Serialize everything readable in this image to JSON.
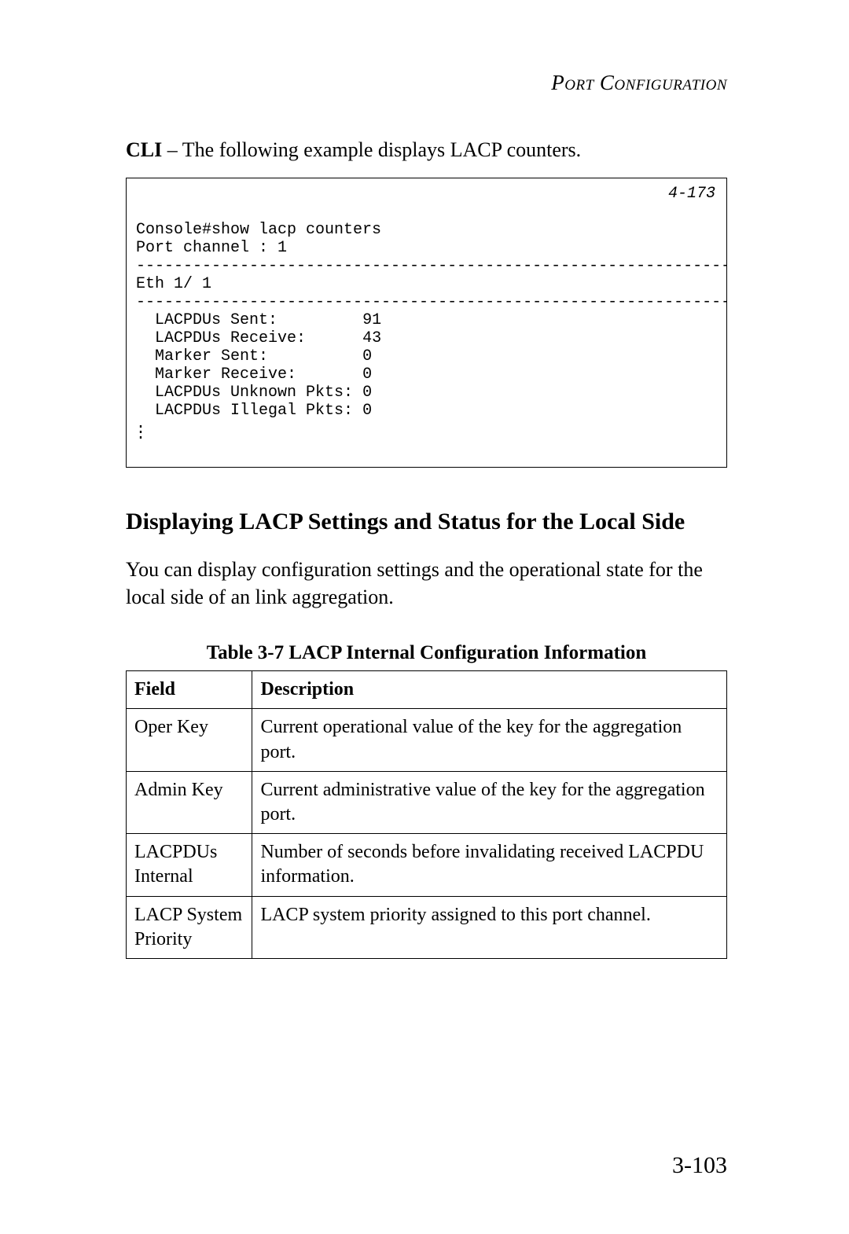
{
  "header": {
    "running_head": "Port Configuration"
  },
  "cli_intro": {
    "label": "CLI",
    "text": " – The following example displays LACP counters."
  },
  "cli_box": {
    "ref": "4-173",
    "command": "Console#show lacp counters",
    "port_channel_line": "Port channel : 1",
    "rule": "-------------------------------------------------------------------",
    "eth_line": "Eth 1/ 1",
    "rule2": "-------------------------------------------------------------------",
    "rows": [
      {
        "label": "  LACPDUs Sent:",
        "pad": "         ",
        "value": "91"
      },
      {
        "label": "  LACPDUs Receive:",
        "pad": "      ",
        "value": "43"
      },
      {
        "label": "  Marker Sent:",
        "pad": "          ",
        "value": "0"
      },
      {
        "label": "  Marker Receive:",
        "pad": "       ",
        "value": "0"
      },
      {
        "label": "  LACPDUs Unknown Pkts:",
        "pad": " ",
        "value": "0"
      },
      {
        "label": "  LACPDUs Illegal Pkts:",
        "pad": " ",
        "value": "0"
      }
    ]
  },
  "section": {
    "heading": "Displaying LACP Settings and Status for the Local Side",
    "body": "You can display configuration settings and the operational state for the local side of an link aggregation."
  },
  "table": {
    "caption": "Table 3-7  LACP Internal Configuration Information",
    "head_field": "Field",
    "head_desc": "Description",
    "rows": [
      {
        "field": "Oper Key",
        "desc": "Current operational value of the key for the aggregation port."
      },
      {
        "field": "Admin Key",
        "desc": "Current administrative value of the key for the aggregation port."
      },
      {
        "field": "LACPDUs Internal",
        "desc": "Number of seconds before invalidating received LACPDU information."
      },
      {
        "field": "LACP System Priority",
        "desc": "LACP system priority assigned to this port channel."
      }
    ]
  },
  "footer": {
    "page_number": "3-103"
  }
}
